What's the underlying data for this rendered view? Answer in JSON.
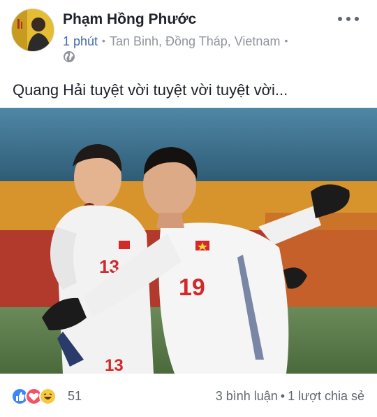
{
  "post": {
    "author_name": "Phạm Hồng Phước",
    "timestamp": "1 phút",
    "location": "Tan Binh, Đồng Tháp, Vietnam",
    "separator": "•",
    "privacy_icon": "globe-icon",
    "more_icon": "more-options-icon",
    "text": "Quang Hải tuyệt vời tuyệt vời tuyệt vời...",
    "photo": {
      "jersey_numbers": [
        "13",
        "19",
        "13"
      ]
    }
  },
  "footer": {
    "reaction_icons": [
      "like-icon",
      "love-icon",
      "haha-icon"
    ],
    "reaction_count": "51",
    "comments": "3 bình luận",
    "separator": "•",
    "shares": "1 lượt chia sẻ"
  },
  "colors": {
    "link": "#4267b2",
    "secondary_text": "#90949c",
    "like": "#3b86f7",
    "love": "#f25268",
    "haha": "#f7c93f"
  }
}
